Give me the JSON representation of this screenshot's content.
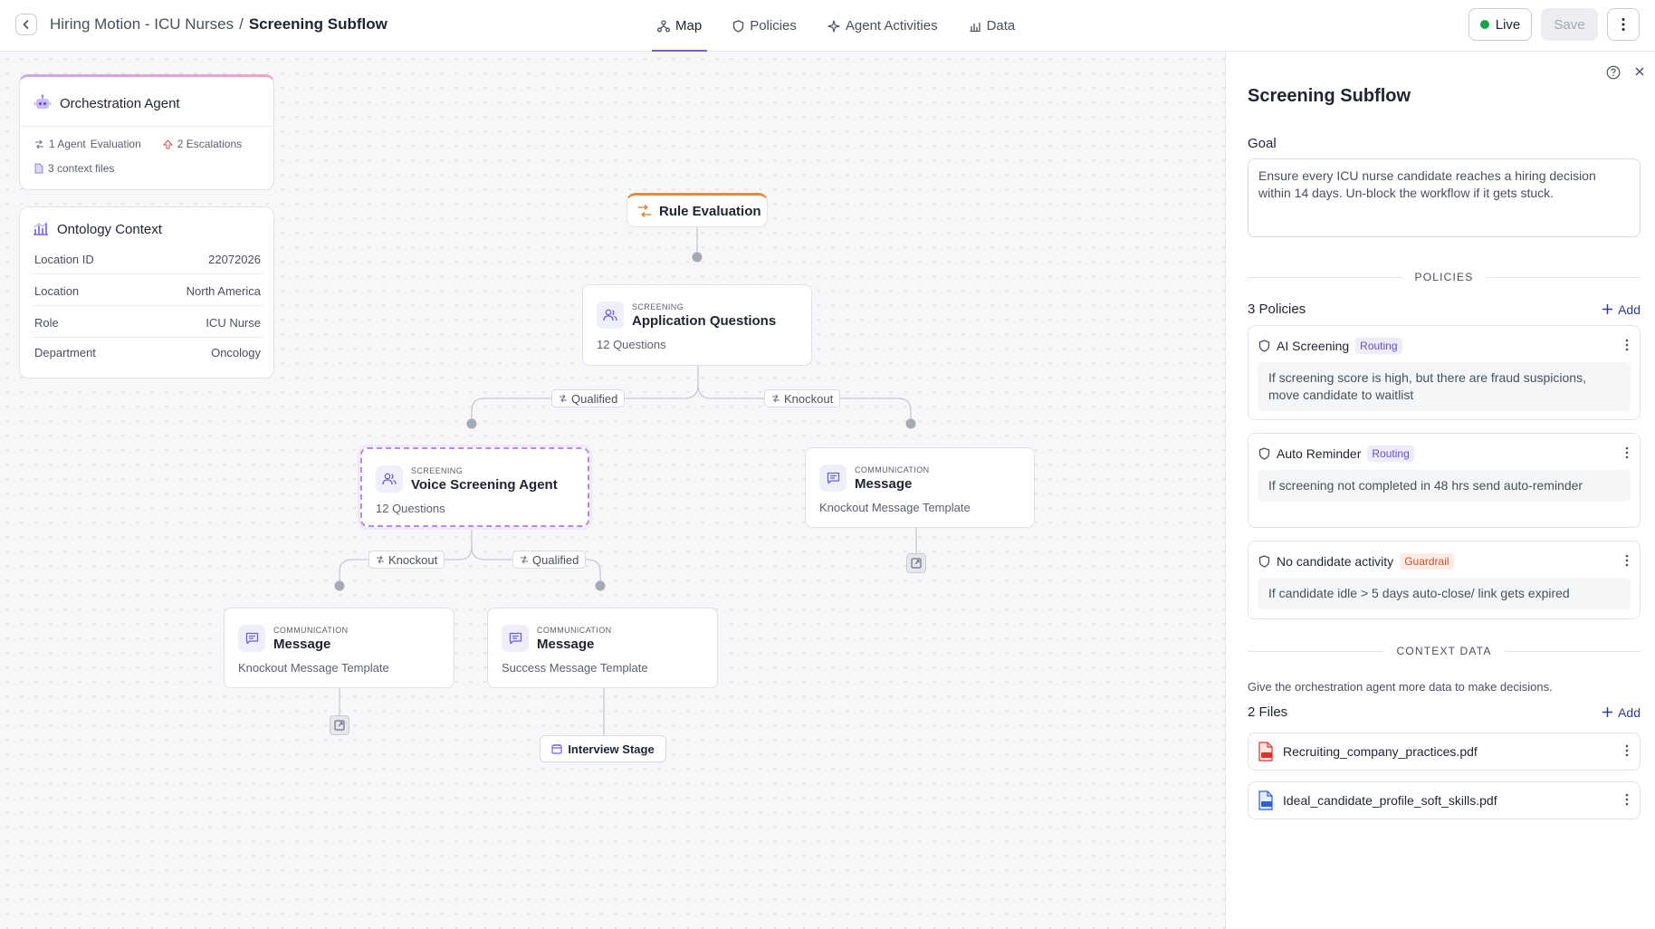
{
  "header": {
    "breadcrumb_parent": "Hiring Motion - ICU Nurses",
    "breadcrumb_separator": "/",
    "breadcrumb_current": "Screening Subflow",
    "tabs": [
      {
        "label": "Map",
        "icon": "map-icon",
        "active": true
      },
      {
        "label": "Policies",
        "icon": "shield-icon",
        "active": false
      },
      {
        "label": "Agent Activities",
        "icon": "sparkle-icon",
        "active": false
      },
      {
        "label": "Data",
        "icon": "chart-icon",
        "active": false
      }
    ],
    "live_label": "Live",
    "save_label": "Save"
  },
  "orchestration": {
    "title": "Orchestration Agent",
    "agent_eval": "1 Agent",
    "agent_eval_suffix": "Evaluation",
    "escalations": "2 Escalations",
    "context_files": "3 context files"
  },
  "ontology": {
    "title": "Ontology Context",
    "rows": [
      {
        "key": "Location ID",
        "value": "22072026"
      },
      {
        "key": "Location",
        "value": "North America"
      },
      {
        "key": "Role",
        "value": "ICU Nurse"
      },
      {
        "key": "Department",
        "value": "Oncology"
      }
    ]
  },
  "flow": {
    "rule": "Rule Evaluation",
    "app_questions": {
      "category": "SCREENING",
      "name": "Application Questions",
      "sub": "12 Questions"
    },
    "voice_agent": {
      "category": "SCREENING",
      "name": "Voice Screening Agent",
      "sub": "12 Questions"
    },
    "knockout_msg_top": {
      "category": "COMMUNICATION",
      "name": "Message",
      "sub": "Knockout Message Template"
    },
    "knockout_msg_bottom": {
      "category": "COMMUNICATION",
      "name": "Message",
      "sub": "Knockout Message Template"
    },
    "success_msg": {
      "category": "COMMUNICATION",
      "name": "Message",
      "sub": "Success Message Template"
    },
    "edge_labels": {
      "qualified_top": "Qualified",
      "knockout_top": "Knockout",
      "knockout_bottom": "Knockout",
      "qualified_bottom": "Qualified"
    },
    "interview_stage": "Interview Stage"
  },
  "panel": {
    "title": "Screening Subflow",
    "goal_label": "Goal",
    "goal_text": "Ensure every ICU nurse candidate reaches a hiring decision within 14 days. Un-block the workflow if it gets stuck.",
    "policies_header": "POLICIES",
    "policies_count": "3 Policies",
    "add_label": "Add",
    "policies": [
      {
        "name": "AI Screening",
        "badge": "Routing",
        "text": "If screening score is high, but there are fraud suspicions, move candidate to waitlist"
      },
      {
        "name": "Auto Reminder",
        "badge": "Routing",
        "text": "If screening not completed in 48 hrs send auto-reminder"
      },
      {
        "name": "No candidate activity",
        "badge": "Guardrail",
        "text": "If candidate idle > 5 days auto-close/ link gets expired"
      }
    ],
    "context_header": "CONTEXT DATA",
    "context_desc": "Give the orchestration agent more data to make decisions.",
    "files_count": "2 Files",
    "files": [
      {
        "name": "Recruiting_company_practices.pdf",
        "icon": "pdf-file-icon",
        "color": "#d9342b"
      },
      {
        "name": "Ideal_candidate_profile_soft_skills.pdf",
        "icon": "doc-file-icon",
        "color": "#2f5fd0"
      }
    ]
  },
  "colors": {
    "accent": "#6d5fd9",
    "live": "#18a34a",
    "rule_border": "#e08a3c",
    "routing": "#5f52c7",
    "guardrail": "#c2562e"
  }
}
